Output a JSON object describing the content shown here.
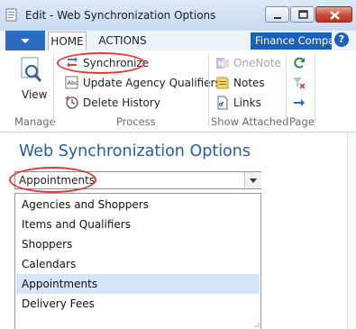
{
  "window": {
    "title": "Edit - Web Synchronization Options",
    "icons": [
      "app-icon",
      "minimize-icon",
      "maximize-icon",
      "close-icon"
    ]
  },
  "ribbon": {
    "tabs": [
      {
        "label": "HOME",
        "active": true
      },
      {
        "label": "ACTIONS",
        "active": false
      }
    ],
    "company": "Finance Compa...",
    "help": "?",
    "groups": {
      "manage": {
        "label": "Manage",
        "items": [
          {
            "label": "View",
            "icon": "view-magnifier-icon"
          }
        ]
      },
      "process": {
        "label": "Process",
        "items": [
          {
            "label": "Synchronize",
            "icon": "synchronize-icon"
          },
          {
            "label": "Update Agency Qualifiers",
            "icon": "update-qualifiers-icon"
          },
          {
            "label": "Delete History",
            "icon": "delete-history-icon"
          }
        ]
      },
      "show_attached": {
        "label": "Show Attached",
        "items": [
          {
            "label": "OneNote",
            "icon": "onenote-icon",
            "enabled": false
          },
          {
            "label": "Notes",
            "icon": "notes-icon",
            "enabled": true
          },
          {
            "label": "Links",
            "icon": "links-icon",
            "enabled": true
          }
        ]
      },
      "page": {
        "label": "Page",
        "items": [
          {
            "icon": "refresh-icon"
          },
          {
            "icon": "clear-filter-icon"
          },
          {
            "icon": "next-arrow-icon"
          }
        ]
      }
    }
  },
  "main": {
    "title": "Web Synchronization Options",
    "combo": {
      "value": "Appointments",
      "options": [
        "Agencies and Shoppers",
        "Items and Qualifiers",
        "Shoppers",
        "Calendars",
        "Appointments",
        "Delivery Fees"
      ],
      "selected_index": 4
    }
  },
  "colors": {
    "accent": "#2a6bbf",
    "company_bg": "#1c61b8",
    "title_text": "#2a5c9a",
    "highlight_oval": "#e03a3a",
    "selected_option": "#d7e6f7"
  }
}
